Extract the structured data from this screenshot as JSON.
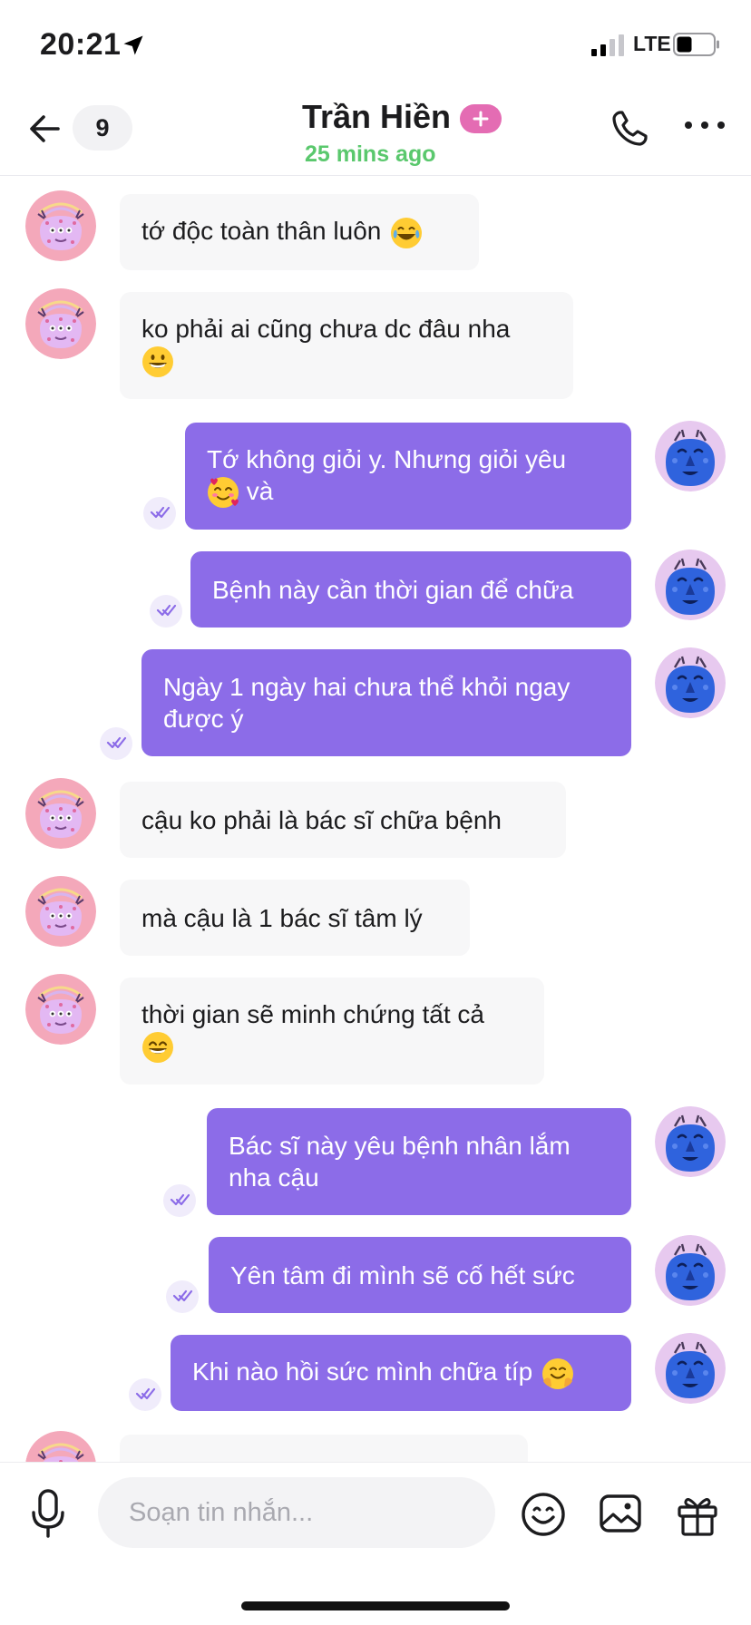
{
  "status_bar": {
    "time": "20:21",
    "network": "LTE"
  },
  "header": {
    "back_icon": "arrow-left-icon",
    "unread_count": "9",
    "contact_name": "Trần Hiền",
    "plus_badge_icon": "plus-icon",
    "last_seen": "25 mins ago",
    "call_icon": "phone-icon",
    "more_icon": "more-dots-icon"
  },
  "colors": {
    "outgoing_bubble": "#8c6ce8",
    "incoming_bubble": "#f7f7f8",
    "online_green": "#5ac86d",
    "badge_pink": "#e46cb3"
  },
  "messages": [
    {
      "from": "them",
      "line1": "tớ độc toàn thân luôn",
      "line2": "",
      "emoji": "joy-emoji"
    },
    {
      "from": "them",
      "line1": "ko phải ai cũng chưa dc đâu nha",
      "line2": "",
      "emoji": "grin-emoji"
    },
    {
      "from": "me",
      "line1": "Tớ không giỏi y. Nhưng giỏi yêu",
      "line2": "và",
      "emoji": "smiling-hearts-emoji"
    },
    {
      "from": "me",
      "line1": "Bệnh này cần thời gian để chữa",
      "line2": "",
      "emoji": ""
    },
    {
      "from": "me",
      "line1": "Ngày 1 ngày hai chưa thể khỏi ngay",
      "line2": "được ý",
      "emoji": ""
    },
    {
      "from": "them",
      "line1": "cậu ko phải là bác sĩ chữa bệnh",
      "line2": "",
      "emoji": ""
    },
    {
      "from": "them",
      "line1": "mà cậu là 1 bác sĩ tâm lý",
      "line2": "",
      "emoji": ""
    },
    {
      "from": "them",
      "line1": "thời gian sẽ minh chứng tất cả",
      "line2": "",
      "emoji": "smile-emoji"
    },
    {
      "from": "me",
      "line1": "Bác sĩ này yêu bệnh nhân lắm",
      "line2": "nha cậu",
      "emoji": ""
    },
    {
      "from": "me",
      "line1": "Yên tâm đi mình sẽ cố hết sức",
      "line2": "",
      "emoji": ""
    },
    {
      "from": "me",
      "line1": "Khi nào hồi sức mình chữa típ",
      "line2": "",
      "emoji": "hugging-emoji"
    }
  ],
  "composer": {
    "placeholder": "Soạn tin nhắn...",
    "mic_icon": "microphone-icon",
    "emoji_icon": "smiley-icon",
    "image_icon": "image-icon",
    "gift_icon": "gift-icon"
  }
}
